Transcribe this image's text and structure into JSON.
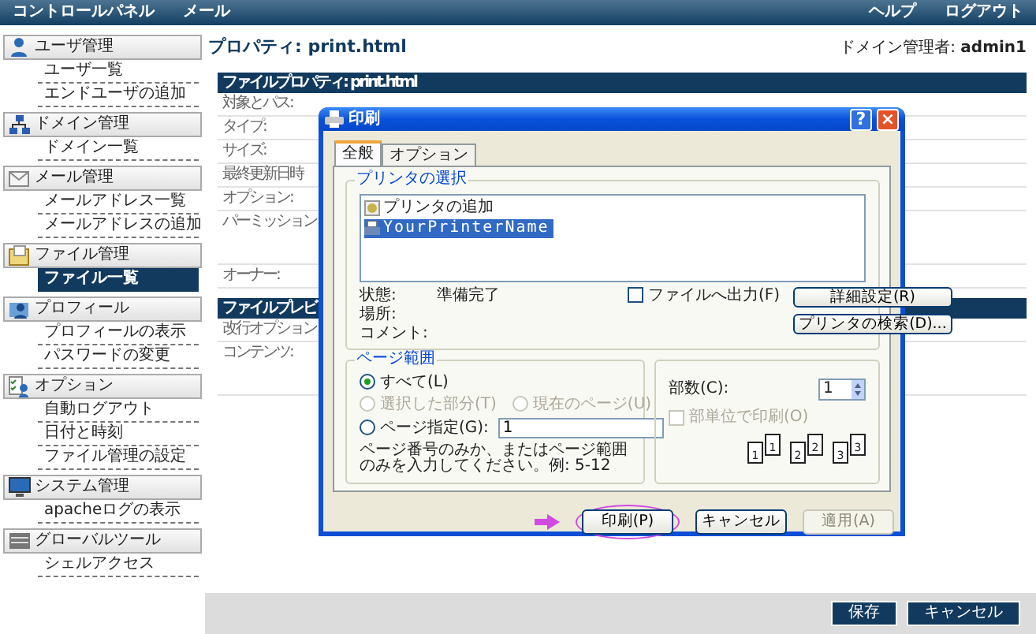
{
  "top_bar": {
    "left_links": [
      "コントロールパネル",
      "メール"
    ],
    "right_links": [
      "ヘルプ",
      "ログアウト"
    ]
  },
  "sidebar": {
    "sections": [
      {
        "title": "ユーザ管理",
        "items": [
          {
            "label": "ユーザ一覧",
            "selected": false
          },
          {
            "label": "エンドユーザの追加",
            "selected": false
          }
        ]
      },
      {
        "title": "ドメイン管理",
        "items": [
          {
            "label": "ドメイン一覧",
            "selected": false
          }
        ]
      },
      {
        "title": "メール管理",
        "items": [
          {
            "label": "メールアドレス一覧",
            "selected": false
          },
          {
            "label": "メールアドレスの追加",
            "selected": false
          }
        ]
      },
      {
        "title": "ファイル管理",
        "items": [
          {
            "label": "ファイル一覧",
            "selected": true
          }
        ]
      },
      {
        "title": "プロフィール",
        "items": [
          {
            "label": "プロフィールの表示",
            "selected": false
          },
          {
            "label": "パスワードの変更",
            "selected": false
          }
        ]
      },
      {
        "title": "オプション",
        "items": [
          {
            "label": "自動ログアウト",
            "selected": false
          },
          {
            "label": "日付と時刻",
            "selected": false
          },
          {
            "label": "ファイル管理の設定",
            "selected": false
          }
        ]
      },
      {
        "title": "システム管理",
        "items": [
          {
            "label": "apacheログの表示",
            "selected": false
          }
        ]
      },
      {
        "title": "グローバルツール",
        "items": [
          {
            "label": "シェルアクセス",
            "selected": false
          }
        ]
      }
    ]
  },
  "page": {
    "title": "プロパティ: print.html",
    "admin": "ドメイン管理者: **admin1**",
    "panels": [
      {
        "header": "ファイルプロパティ: print.html",
        "rows": [
          {
            "label": "対象とパス:",
            "tall": false
          },
          {
            "label": "タイプ:",
            "tall": false
          },
          {
            "label": "サイズ:",
            "tall": false
          },
          {
            "label": "最終更新日時",
            "tall": false
          },
          {
            "label": "オプション:",
            "tall": false
          },
          {
            "label": "パーミッション",
            "tall": true
          },
          {
            "label": "オーナー:",
            "tall": false
          }
        ]
      },
      {
        "header": "ファイルプレビ",
        "rows": [
          {
            "label": "改行オプション",
            "tall": false
          },
          {
            "label": "コンテンツ:",
            "tall": true
          }
        ]
      }
    ],
    "buttons": [
      "保存",
      "キャンセル"
    ]
  },
  "dialog": {
    "title": "印刷",
    "help": "?",
    "close": "×",
    "tabs": [
      {
        "label": "全般",
        "selected": true
      },
      {
        "label": "オプション",
        "selected": false
      }
    ],
    "printer_group": {
      "title": "プリンタの選択",
      "printers": [
        {
          "label": "プリンタの追加",
          "selected": false
        },
        {
          "label": "YourPrinterName",
          "selected": true
        }
      ],
      "info": [
        {
          "label": "状態:",
          "value": "準備完了"
        },
        {
          "label": "場所:"
        },
        {
          "label": "コメント:"
        }
      ],
      "print_to_file": {
        "label": "ファイルへ出力(F)",
        "checked": false
      },
      "buttons": [
        "詳細設定(R)",
        "プリンタの検索(D)..."
      ]
    },
    "range_group": {
      "title": "ページ範囲",
      "options": [
        {
          "label": "すべて(L)",
          "selected": true,
          "disabled": false
        },
        {
          "label": "選択した部分(T)",
          "selected": false,
          "disabled": true
        },
        {
          "label": "現在のページ(U)",
          "selected": false,
          "disabled": true
        },
        {
          "label": "ページ指定(G):",
          "selected": false,
          "disabled": false
        }
      ],
      "pages_value": "1",
      "hint": "ページ番号のみか、またはページ範囲のみを入力してください。例: 5-12"
    },
    "copies_group": {
      "label": "部数(C):",
      "value": "1",
      "collate": {
        "label": "部単位で印刷(O)",
        "checked": false,
        "disabled": true
      },
      "collate_pages": [
        "1",
        "1",
        "2",
        "2",
        "3",
        "3"
      ]
    },
    "buttons": [
      {
        "label": "印刷(P)",
        "disabled": false,
        "highlighted": true
      },
      {
        "label": "キャンセル",
        "disabled": false,
        "highlighted": false
      },
      {
        "label": "適用(A)",
        "disabled": true,
        "highlighted": false
      }
    ]
  }
}
